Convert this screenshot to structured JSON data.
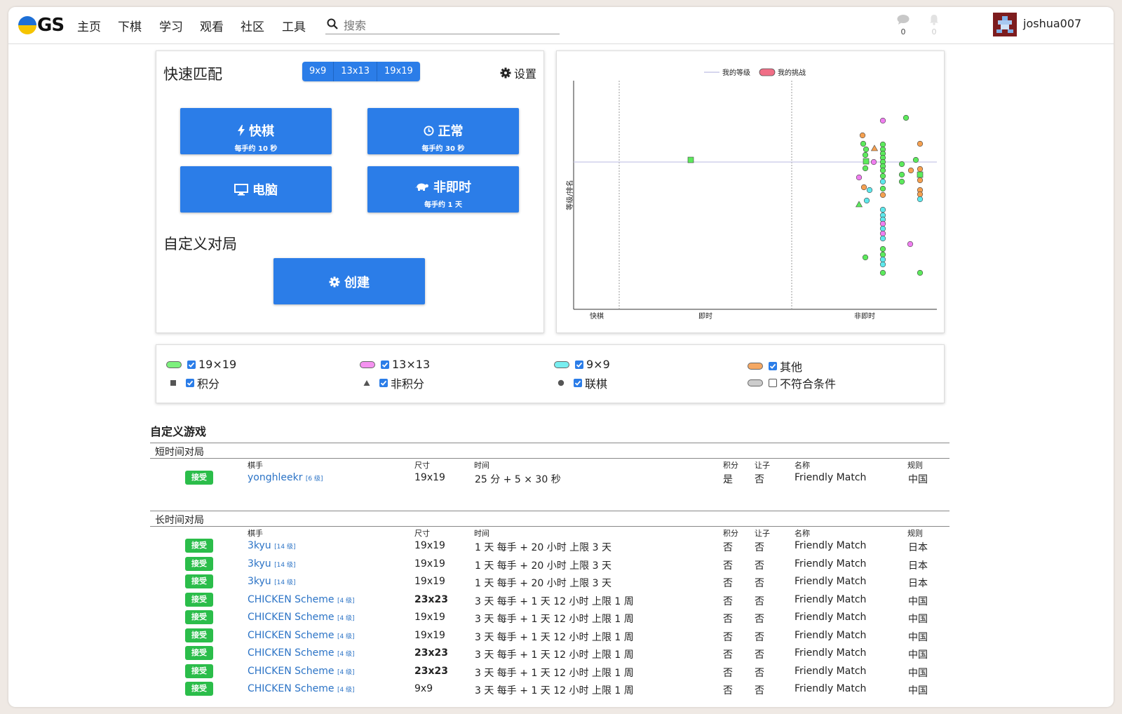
{
  "app": {
    "logo_text": "GS",
    "logo_colors": {
      "top": "#1d6fd6",
      "bottom": "#f5c400"
    }
  },
  "nav": {
    "items": [
      "主页",
      "下棋",
      "学习",
      "观看",
      "社区",
      "工具"
    ],
    "search_placeholder": "搜索"
  },
  "header": {
    "chat_count": "0",
    "notif_count": "0",
    "username": "joshua007"
  },
  "quick_match": {
    "title": "快速匹配",
    "sizes": [
      "9x9",
      "13x13",
      "19x19"
    ],
    "settings_label": "设置",
    "buttons": [
      {
        "label": "快棋",
        "sub": "每手约 10 秒",
        "icon": "bolt-icon"
      },
      {
        "label": "正常",
        "sub": "每手约 30 秒",
        "icon": "clock-icon"
      },
      {
        "label": "电脑",
        "sub": "",
        "icon": "monitor-icon"
      },
      {
        "label": "非即时",
        "sub": "每手约 1 天",
        "icon": "turtle-icon"
      }
    ],
    "custom_title": "自定义对局",
    "create_label": "创建"
  },
  "chart_data": {
    "type": "scatter",
    "legend": [
      "我的等级",
      "我的挑战"
    ],
    "ylabel": "等级/排名",
    "xcategories": [
      "快棋",
      "即时",
      "非即时"
    ],
    "colors": {
      "19x19": "#5cea5c",
      "13x13": "#f07ef0",
      "9x9": "#5ee8ec",
      "other": "#f5a050",
      "my_rank_line": "#c8c8e8",
      "my_challenge": "#f06e86"
    }
  },
  "filters": {
    "items": [
      {
        "label": "19×19",
        "checked": true,
        "color": "#7df07d",
        "marker": "pill"
      },
      {
        "label": "13×13",
        "checked": true,
        "color": "#f592f0",
        "marker": "pill"
      },
      {
        "label": "9×9",
        "checked": true,
        "color": "#78eef0",
        "marker": "pill"
      },
      {
        "label": "其他",
        "checked": true,
        "color": "#f5a863",
        "marker": "pill"
      },
      {
        "label": "积分",
        "checked": true,
        "marker": "square"
      },
      {
        "label": "非积分",
        "checked": true,
        "marker": "triangle"
      },
      {
        "label": "联棋",
        "checked": true,
        "marker": "circle"
      },
      {
        "label": "不符合条件",
        "checked": false,
        "color": "#cccccc",
        "marker": "pill"
      }
    ]
  },
  "games": {
    "title": "自定义游戏",
    "columns": {
      "player": "棋手",
      "size": "尺寸",
      "time": "时间",
      "ranked": "积分",
      "handicap": "让子",
      "name": "名称",
      "rules": "规则"
    },
    "accept_label": "接受",
    "short": {
      "title": "短时间对局",
      "rows": [
        {
          "player": "yonghleekr",
          "rank": "[6 级]",
          "size": "19x19",
          "size_bold": false,
          "time": "25 分 + 5 × 30 秒",
          "ranked": "是",
          "handicap": "否",
          "name": "Friendly Match",
          "rules": "中国"
        }
      ]
    },
    "long": {
      "title": "长时间对局",
      "rows": [
        {
          "player": "3kyu",
          "rank": "[14 级]",
          "size": "19x19",
          "size_bold": false,
          "time": "1 天 每手 + 20 小时 上限 3 天",
          "ranked": "否",
          "handicap": "否",
          "name": "Friendly Match",
          "rules": "日本"
        },
        {
          "player": "3kyu",
          "rank": "[14 级]",
          "size": "19x19",
          "size_bold": false,
          "time": "1 天 每手 + 20 小时 上限 3 天",
          "ranked": "否",
          "handicap": "否",
          "name": "Friendly Match",
          "rules": "日本"
        },
        {
          "player": "3kyu",
          "rank": "[14 级]",
          "size": "19x19",
          "size_bold": false,
          "time": "1 天 每手 + 20 小时 上限 3 天",
          "ranked": "否",
          "handicap": "否",
          "name": "Friendly Match",
          "rules": "日本"
        },
        {
          "player": "CHICKEN Scheme",
          "rank": "[4 级]",
          "size": "23x23",
          "size_bold": true,
          "time": "3 天 每手 + 1 天 12 小时 上限 1 周",
          "ranked": "否",
          "handicap": "否",
          "name": "Friendly Match",
          "rules": "中国"
        },
        {
          "player": "CHICKEN Scheme",
          "rank": "[4 级]",
          "size": "19x19",
          "size_bold": false,
          "time": "3 天 每手 + 1 天 12 小时 上限 1 周",
          "ranked": "否",
          "handicap": "否",
          "name": "Friendly Match",
          "rules": "中国"
        },
        {
          "player": "CHICKEN Scheme",
          "rank": "[4 级]",
          "size": "19x19",
          "size_bold": false,
          "time": "3 天 每手 + 1 天 12 小时 上限 1 周",
          "ranked": "否",
          "handicap": "否",
          "name": "Friendly Match",
          "rules": "中国"
        },
        {
          "player": "CHICKEN Scheme",
          "rank": "[4 级]",
          "size": "23x23",
          "size_bold": true,
          "time": "3 天 每手 + 1 天 12 小时 上限 1 周",
          "ranked": "否",
          "handicap": "否",
          "name": "Friendly Match",
          "rules": "中国"
        },
        {
          "player": "CHICKEN Scheme",
          "rank": "[4 级]",
          "size": "23x23",
          "size_bold": true,
          "time": "3 天 每手 + 1 天 12 小时 上限 1 周",
          "ranked": "否",
          "handicap": "否",
          "name": "Friendly Match",
          "rules": "中国"
        },
        {
          "player": "CHICKEN Scheme",
          "rank": "[4 级]",
          "size": "9x9",
          "size_bold": false,
          "time": "3 天 每手 + 1 天 12 小时 上限 1 周",
          "ranked": "否",
          "handicap": "否",
          "name": "Friendly Match",
          "rules": "中国"
        }
      ]
    }
  }
}
